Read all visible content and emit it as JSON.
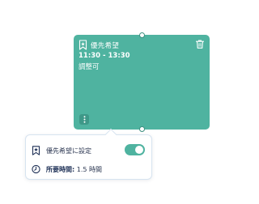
{
  "event": {
    "title": "優先希望",
    "time": "11:30 - 13:30",
    "note": "調整可",
    "color": "#4fb3a0"
  },
  "popover": {
    "priority_label": "優先希望に設定",
    "priority_enabled": true,
    "duration_label": "所要時間:",
    "duration_value": "1.5 時間"
  },
  "icons": {
    "event_badge": "bookmark-star-icon",
    "delete": "trash-icon",
    "menu": "more-vertical-icon",
    "priority": "bookmark-star-icon",
    "duration": "clock-icon"
  }
}
